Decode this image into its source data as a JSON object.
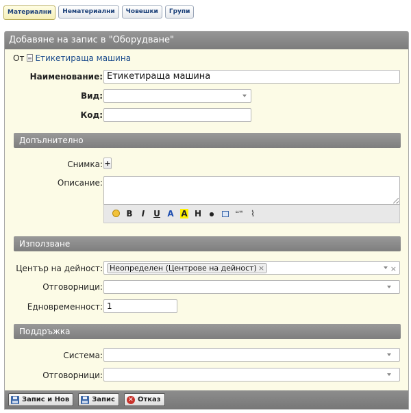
{
  "tabs": [
    "Материални",
    "Нематериални",
    "Човешки",
    "Групи"
  ],
  "active_tab": 0,
  "form": {
    "title": "Добавяне на запис в \"Оборудване\"",
    "from_label": "От",
    "from_link": "Етикетираща машина",
    "name_label": "Наименование:",
    "name_value": "Етикетираща машина",
    "type_label": "Вид:",
    "type_value": "",
    "code_label": "Код:",
    "code_value": ""
  },
  "sections": {
    "additional": "Допълнително",
    "usage": "Използване",
    "support": "Поддръжка"
  },
  "additional": {
    "photo_label": "Снимка:",
    "photo_add": "+",
    "description_label": "Описание:"
  },
  "editor_toolbar": [
    "smiley-icon",
    "bold",
    "italic",
    "underline",
    "text-color",
    "highlight",
    "heading",
    "bullet",
    "table",
    "quote",
    "attach"
  ],
  "editor_labels": {
    "bold": "B",
    "italic": "I",
    "underline": "U",
    "text_color": "A",
    "highlight": "A",
    "heading": "H",
    "bullet": "●",
    "quote": "❝❞"
  },
  "usage": {
    "center_label": "Център на дейност:",
    "center_chip": "Неопределен (Центрове на дейност)",
    "responsible_label": "Отговорници:",
    "simultaneity_label": "Едновременност:",
    "simultaneity_value": "1"
  },
  "support": {
    "system_label": "Система:",
    "responsible_label": "Отговорници:"
  },
  "buttons": {
    "save_new": "Запис и Нов",
    "save": "Запис",
    "cancel": "Отказ"
  },
  "colors": {
    "header_gray": "#7c7c7c",
    "form_bg": "#fcfbe6",
    "link_blue": "#1a4b8c"
  }
}
